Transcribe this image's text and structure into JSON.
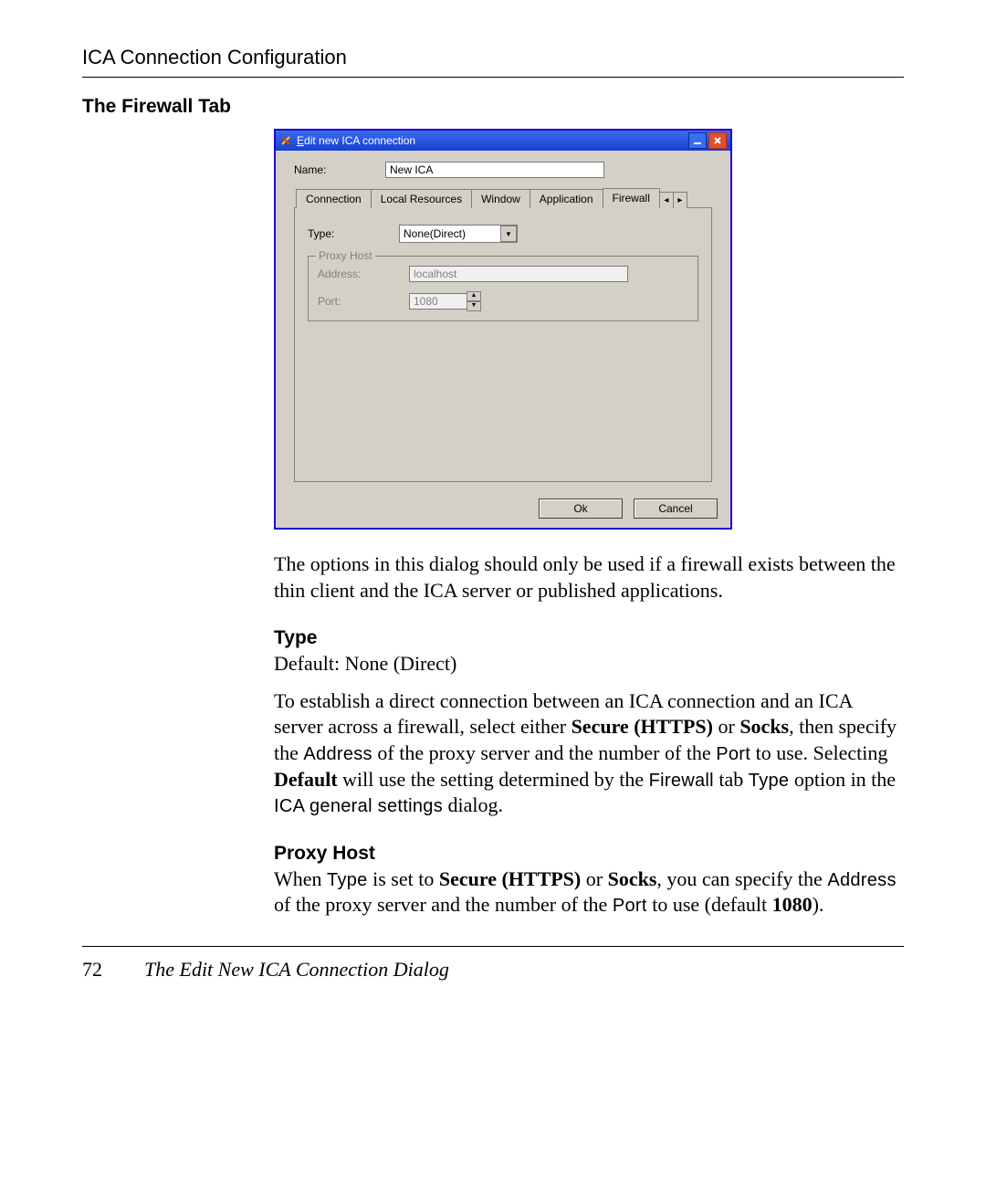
{
  "header": {
    "title": "ICA Connection Configuration"
  },
  "section_title": "The Firewall Tab",
  "dialog": {
    "title_prefix": "E",
    "title_rest": "dit new ICA connection",
    "name_label": "Name:",
    "name_value": "New ICA",
    "tabs": [
      "Connection",
      "Local Resources",
      "Window",
      "Application",
      "Firewall"
    ],
    "type_label": "Type:",
    "type_value": "None(Direct)",
    "groupbox_label": "Proxy Host",
    "address_label": "Address:",
    "address_value": "localhost",
    "port_label": "Port:",
    "port_value": "1080",
    "ok": "Ok",
    "cancel": "Cancel"
  },
  "para1": "The options in this dialog should only be used if a firewall exists between the thin client and the ICA server or published applications.",
  "type_heading": "Type",
  "type_default": "Default: None (Direct)",
  "type_p1_a": "To establish a direct connection between an ICA connection and an ICA server across a firewall, select either ",
  "type_p1_secure": "Secure (HTTPS)",
  "type_p1_or": " or ",
  "type_p1_socks": "Socks",
  "type_p1_b": ", then specify the ",
  "type_p1_address": "Address",
  "type_p1_c": " of the proxy server and the number of the ",
  "type_p1_port": "Port",
  "type_p1_d": " to use. Selecting ",
  "type_p1_default": "Default",
  "type_p1_e": " will use the setting determined by the ",
  "type_p1_fwtab": "Firewall",
  "type_p1_f": " tab ",
  "type_p1_typeopt": "Type",
  "type_p1_g": " option in the ",
  "type_p1_icagen": "ICA general settings",
  "type_p1_h": " dialog.",
  "proxy_heading": "Proxy Host",
  "proxy_p_a": "When ",
  "proxy_p_type": "Type",
  "proxy_p_b": " is set to ",
  "proxy_p_secure": "Secure (HTTPS)",
  "proxy_p_or": " or ",
  "proxy_p_socks": "Socks",
  "proxy_p_c": ", you can specify the ",
  "proxy_p_address": "Address",
  "proxy_p_d": " of the proxy server and the number of the ",
  "proxy_p_port": "Port",
  "proxy_p_e": " to use (default ",
  "proxy_p_defval": "1080",
  "proxy_p_f": ").",
  "footer": {
    "page": "72",
    "title": "The Edit New ICA Connection Dialog"
  }
}
